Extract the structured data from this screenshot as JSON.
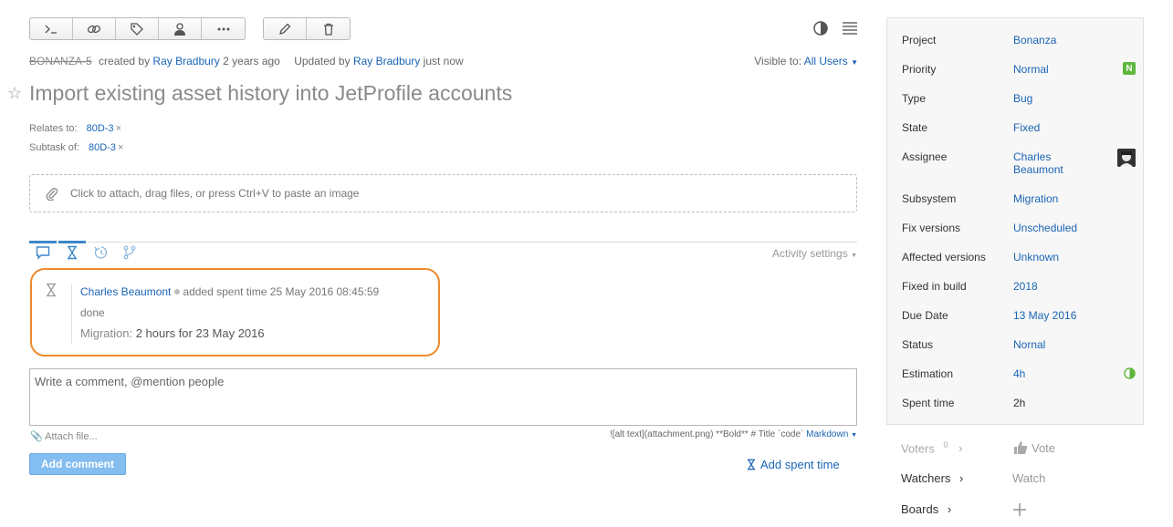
{
  "toolbar": {
    "group1": [
      {
        "name": "command-icon"
      },
      {
        "name": "link-icon"
      },
      {
        "name": "tag-icon"
      },
      {
        "name": "user-icon"
      },
      {
        "name": "more-icon"
      }
    ],
    "group2": [
      {
        "name": "pencil-icon"
      },
      {
        "name": "trash-icon"
      }
    ]
  },
  "issue": {
    "id": "BONANZA-5",
    "created_prefix": "created by",
    "creator": "Ray Bradbury",
    "created_when": "2 years ago",
    "updated_prefix": "Updated by",
    "updater": "Ray Bradbury",
    "updated_when": "just now",
    "visible_label": "Visible to:",
    "visible_value": "All Users",
    "title": "Import existing asset history into JetProfile accounts"
  },
  "links": {
    "relates_label": "Relates to:",
    "relates_value": "80D-3",
    "subtask_label": "Subtask of:",
    "subtask_value": "80D-3",
    "remove": "×"
  },
  "attach_zone": "Click to attach, drag files, or press Ctrl+V to paste an image",
  "activity": {
    "settings_label": "Activity settings",
    "author": "Charles Beaumont",
    "action": "added spent time 25 May 2016 08:45:59",
    "text": "done",
    "work_label": "Migration:",
    "work_value": "2 hours for 23 May 2016"
  },
  "comment": {
    "placeholder": "Write a comment, @mention people",
    "attach_label": "Attach file...",
    "markup_hint": "![alt text](attachment.png) **Bold** # Title `code`",
    "markup_mode": "Markdown",
    "add_comment": "Add comment",
    "add_spent": "Add spent time"
  },
  "fields": [
    {
      "name": "Project",
      "value": "Bonanza"
    },
    {
      "name": "Priority",
      "value": "Normal",
      "badge": "N"
    },
    {
      "name": "Type",
      "value": "Bug"
    },
    {
      "name": "State",
      "value": "Fixed"
    },
    {
      "name": "Assignee",
      "value_line1": "Charles",
      "value_line2": "Beaumont"
    },
    {
      "name": "Subsystem",
      "value": "Migration"
    },
    {
      "name": "Fix versions",
      "value": "Unscheduled"
    },
    {
      "name": "Affected versions",
      "value": "Unknown"
    },
    {
      "name": "Fixed in build",
      "value": "2018"
    },
    {
      "name": "Due Date",
      "value": "13 May 2016"
    },
    {
      "name": "Status",
      "value": "Nornal"
    },
    {
      "name": "Estimation",
      "value": "4h",
      "progress": 0.5
    },
    {
      "name": "Spent time",
      "value": "2h"
    }
  ],
  "voters": {
    "label": "Voters",
    "count": "0",
    "vote": "Vote"
  },
  "watchers": {
    "label": "Watchers",
    "action": "Watch"
  },
  "boards": {
    "label": "Boards"
  },
  "colors": {
    "accent": "#1a64b5",
    "highlight": "#ee8a2c",
    "badge": "#5db73c"
  }
}
